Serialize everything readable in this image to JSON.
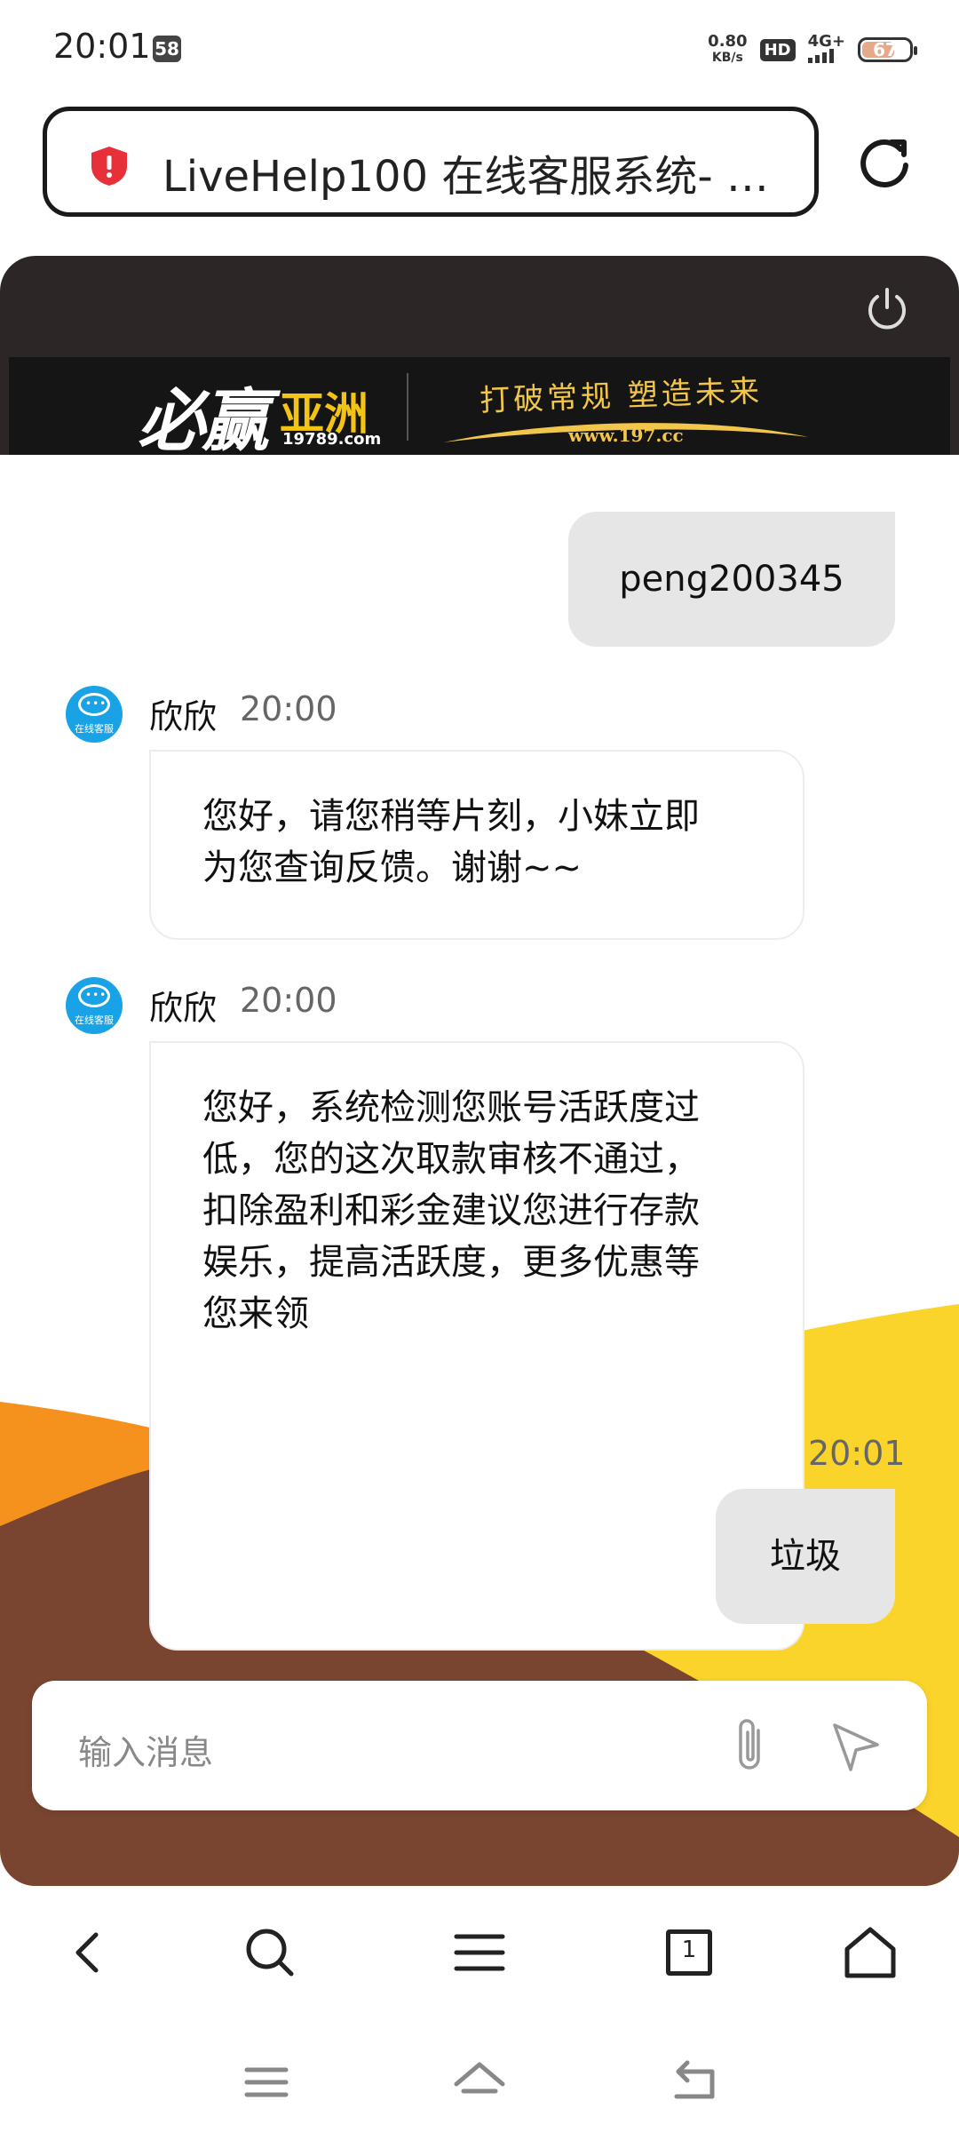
{
  "status_bar": {
    "time": "20:01",
    "badge": "58",
    "net_speed_value": "0.80",
    "net_speed_unit": "KB/s",
    "hd": "HD",
    "signal": "4G+",
    "battery": "67"
  },
  "browser": {
    "page_title": "LiveHelp100 在线客服系统- …",
    "security_icon": "shield-alert-icon",
    "reload_icon": "reload-icon"
  },
  "banner": {
    "brand": "必赢",
    "brand_suffix": "亚洲",
    "brand_site": "19789.com",
    "slogan": "打破常规 塑造未来",
    "slogan_url": "www.197.cc"
  },
  "messages": [
    {
      "side": "out",
      "text": "peng200345"
    },
    {
      "side": "in",
      "sender": "欣欣",
      "time": "20:00",
      "lines": [
        "您好，请您稍等片刻，小妹立即",
        "为您查询反馈。谢谢~~"
      ]
    },
    {
      "side": "in",
      "sender": "欣欣",
      "time": "20:00",
      "lines": [
        "您好，系统检测您账号活跃度过",
        "低，您的这次取款审核不通过，",
        "扣除盈利和彩金建议您进行存款",
        "娱乐，提高活跃度，更多优惠等",
        "您来领"
      ]
    },
    {
      "side": "out",
      "time": "20:01",
      "text": "垃圾"
    }
  ],
  "avatar_caption": "在线客服",
  "composer": {
    "placeholder": "输入消息",
    "attach_icon": "paperclip-icon",
    "send_icon": "send-icon"
  },
  "toolbar": {
    "tabs_count": "1"
  },
  "colors": {
    "header_bg": "#2c2626",
    "wave_yellow": "#fbd42b",
    "wave_orange": "#f5921e",
    "wave_brown": "#7a4530",
    "bubble_out_bg": "#e6e6e6",
    "avatar_blue": "#1aa2e6"
  }
}
